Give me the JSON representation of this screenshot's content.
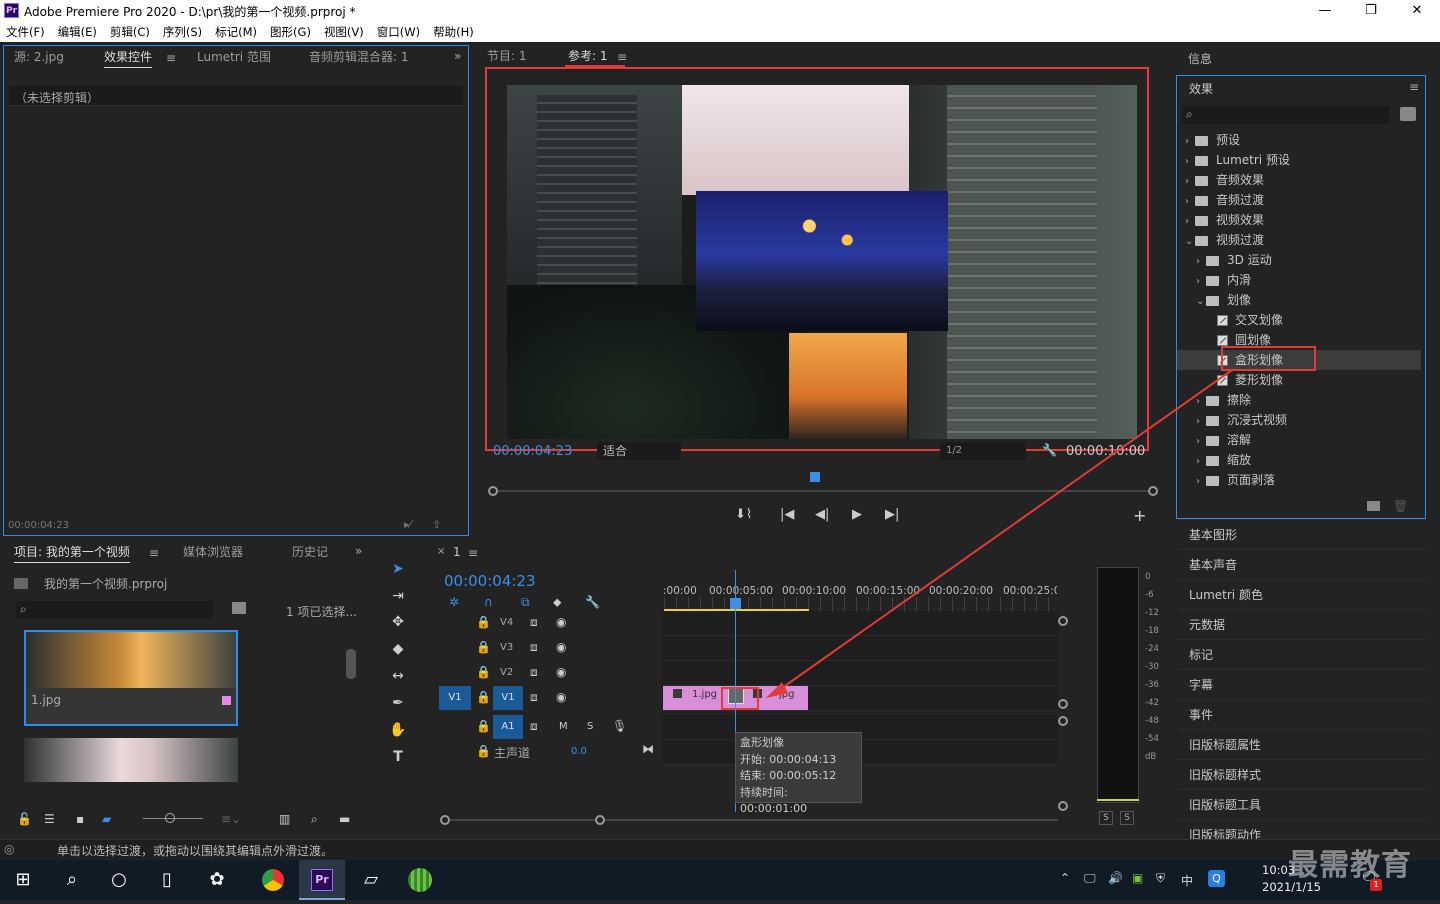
{
  "app": {
    "logo": "Pr",
    "title": "Adobe Premiere Pro 2020 - D:\\pr\\我的第一个视频.prproj *",
    "min": "—",
    "max": "❐",
    "close": "✕"
  },
  "menu": [
    "文件(F)",
    "编辑(E)",
    "剪辑(C)",
    "序列(S)",
    "标记(M)",
    "图形(G)",
    "视图(V)",
    "窗口(W)",
    "帮助(H)"
  ],
  "source_panel": {
    "tabs": [
      "源: 2.jpg",
      "效果控件",
      "Lumetri 范围",
      "音频剪辑混合器: 1"
    ],
    "no_clip": "（未选择剪辑）",
    "timecode": "00:00:04:23"
  },
  "program": {
    "tabs": [
      "节目: 1",
      "参考: 1"
    ],
    "timecode_left": "00:00:04:23",
    "fit": "适合",
    "resolution": "1/2",
    "timecode_right": "00:00:10:00"
  },
  "info_tab": "信息",
  "effects": {
    "title": "效果",
    "items": [
      {
        "label": "预设",
        "level": 0,
        "type": "folder",
        "chev": "›"
      },
      {
        "label": "Lumetri 预设",
        "level": 0,
        "type": "folder",
        "chev": "›"
      },
      {
        "label": "音频效果",
        "level": 0,
        "type": "folder",
        "chev": "›"
      },
      {
        "label": "音频过渡",
        "level": 0,
        "type": "folder",
        "chev": "›"
      },
      {
        "label": "视频效果",
        "level": 0,
        "type": "folder",
        "chev": "›"
      },
      {
        "label": "视频过渡",
        "level": 0,
        "type": "folder",
        "chev": "⌄"
      },
      {
        "label": "3D 运动",
        "level": 1,
        "type": "folder",
        "chev": "›"
      },
      {
        "label": "内滑",
        "level": 1,
        "type": "folder",
        "chev": "›"
      },
      {
        "label": "划像",
        "level": 1,
        "type": "folder",
        "chev": "⌄"
      },
      {
        "label": "交叉划像",
        "level": 2,
        "type": "fx"
      },
      {
        "label": "圆划像",
        "level": 2,
        "type": "fx"
      },
      {
        "label": "盒形划像",
        "level": 2,
        "type": "fx",
        "selected": true
      },
      {
        "label": "菱形划像",
        "level": 2,
        "type": "fx"
      },
      {
        "label": "擦除",
        "level": 1,
        "type": "folder",
        "chev": "›"
      },
      {
        "label": "沉浸式视频",
        "level": 1,
        "type": "folder",
        "chev": "›"
      },
      {
        "label": "溶解",
        "level": 1,
        "type": "folder",
        "chev": "›"
      },
      {
        "label": "缩放",
        "level": 1,
        "type": "folder",
        "chev": "›"
      },
      {
        "label": "页面剥落",
        "level": 1,
        "type": "folder",
        "chev": "›"
      }
    ]
  },
  "right_panels": [
    "基本图形",
    "基本声音",
    "Lumetri 颜色",
    "元数据",
    "标记",
    "字幕",
    "事件",
    "旧版标题属性",
    "旧版标题样式",
    "旧版标题工具",
    "旧版标题动作"
  ],
  "project": {
    "tabs": [
      "项目: 我的第一个视频",
      "媒体浏览器",
      "历史记"
    ],
    "file": "我的第一个视频.prproj",
    "selection": "1 项已选择...",
    "clip1": "1.jpg"
  },
  "timeline": {
    "seq": "1",
    "timecode": "00:00:04:23",
    "ruler": [
      ":00:00",
      "00:00:05:00",
      "00:00:10:00",
      "00:00:15:00",
      "00:00:20:00",
      "00:00:25:0("
    ],
    "tracks": [
      "V4",
      "V3",
      "V2",
      "V1",
      "A1"
    ],
    "src_v1": "V1",
    "src_a1": "A1",
    "master": "主声道",
    "master_val": "0.0",
    "m": "M",
    "s": "S",
    "clip1": "1.jpg",
    "clip2": "jpg",
    "tooltip": {
      "name": "盒形划像",
      "start": "开始: 00:00:04:13",
      "end": "结束: 00:00:05:12",
      "duration": "持续时间: 00:00:01:00"
    }
  },
  "meter": {
    "labels": [
      "0",
      "-6",
      "-12",
      "-18",
      "-24",
      "-30",
      "-36",
      "-42",
      "-48",
      "-54",
      "dB"
    ],
    "solo": [
      "S",
      "S"
    ]
  },
  "status": "单击以选择过渡，或拖动以围绕其编辑点外滑过渡。",
  "taskbar": {
    "time": "10:03",
    "date": "2021/1/15",
    "ime": "中",
    "badge": "1",
    "watermark": "最需教育"
  },
  "colors": {
    "accent": "#2d8ceb",
    "highlight": "#e03a3a",
    "clip": "#d98ed9",
    "timecode": "#3c8fe6"
  }
}
